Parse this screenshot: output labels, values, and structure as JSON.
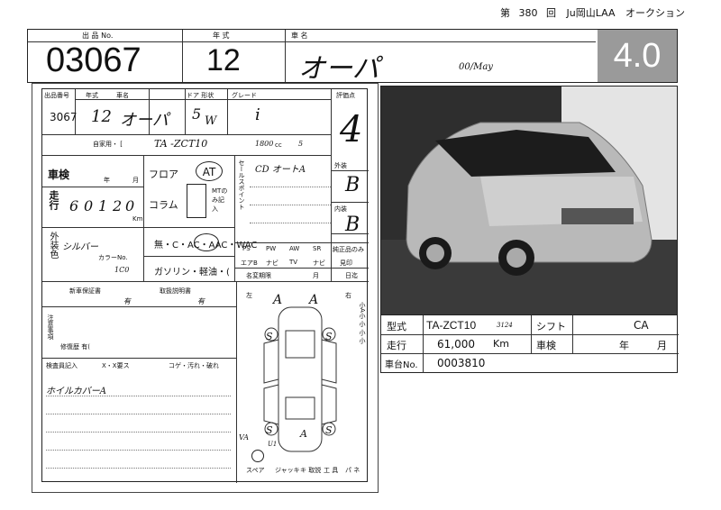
{
  "header": {
    "dai": "第",
    "session_number": "380",
    "kai": "回",
    "auction_house": "Ju岡山LAA",
    "auction_word": "オークション"
  },
  "top_row": {
    "lot_label": "出 品 No.",
    "lot_number": "03067",
    "year_label": "年 式",
    "year_value": "12",
    "model_label": "車 名",
    "model_value": "オーパ",
    "handwritten_note": "00/May",
    "grade": "4.0"
  },
  "sheet_info": {
    "lot_label": "出品番号",
    "lot_value": "3067",
    "year_label": "年式",
    "year_value": "12",
    "name_label": "車名",
    "name_value": "オーパ",
    "door_label": "ドア 形状",
    "door_value": "5",
    "body_value": "W",
    "grade_label": "グレード",
    "grade_value": "i",
    "score_label": "評価点",
    "score_value": "4",
    "private_label": "自家用・ [",
    "model_code_value": "TA -ZCT10",
    "displacement_value": "1800",
    "displacement_unit": "cc",
    "seats_value": "5",
    "inspection_label": "車検",
    "year_unit": "年",
    "month_unit": "月",
    "mileage_label": "走行",
    "mileage_digits": [
      "6",
      "0",
      "1",
      "2",
      "0"
    ],
    "mileage_unit": "Km",
    "floor_label": "フロア",
    "shift_value": "AT",
    "column_label": "コラム",
    "mt_note": "MTのみ記入",
    "color_label": "外装色",
    "color_value": "シルバー",
    "color_code_label": "カラーNo.",
    "color_code_value": "1C0",
    "equipment_label": "無・C・AC・AAC・WAC",
    "equipment_circled": "AAC",
    "fuel_label": "ガソリン・軽油・(",
    "sales_label": "セールスポイント",
    "sales_value": "CD オートA",
    "ext_label": "外装",
    "ext_value": "B",
    "int_label": "内装",
    "int_value": "B",
    "options": [
      "PS",
      "PW",
      "AW",
      "SR"
    ],
    "options2": [
      "エアB",
      "ナビ",
      "TV",
      "ナビ"
    ],
    "genuine_label": "純正品のみ",
    "inspection_col": "見印",
    "name_change_label": "名変期限",
    "deadline_unit_month": "月",
    "deadline_unit_day": "日迄",
    "warranty_label": "新車保証書",
    "warranty_value": "有",
    "manual_label": "取扱説明書",
    "manual_value": "有",
    "notes_label": "注意事項",
    "repair_label": "修復歴 有(",
    "inspector_label": "検査員記入",
    "inspector_legend": "X・X要ス",
    "damage_legend": "コゲ・汚れ・破れ",
    "inspector_note": "ホイルカバーA",
    "diagram_left": "左",
    "diagram_right": "右",
    "diagram_marks": [
      "A",
      "A",
      "S",
      "S",
      "S",
      "S",
      "A",
      "U1",
      "VA"
    ],
    "vertical_legend": "小A小 小 小 小",
    "tools": [
      "スペア",
      "ジャッキ",
      "キ 取説",
      "工 具",
      "パ ネ"
    ]
  },
  "photo": {
    "alt_label": "silver Toyota Opa hatchback photo"
  },
  "specs": {
    "model_label": "型式",
    "model_value": "TA-ZCT10",
    "model_note": "3124",
    "shift_label": "シフト",
    "shift_value": "CA",
    "mileage_label": "走行",
    "mileage_value": "61,000",
    "mileage_unit": "Km",
    "inspection_label": "車検",
    "inspection_year": "年",
    "inspection_month": "月",
    "chassis_label": "車台No.",
    "chassis_value": "0003810"
  }
}
